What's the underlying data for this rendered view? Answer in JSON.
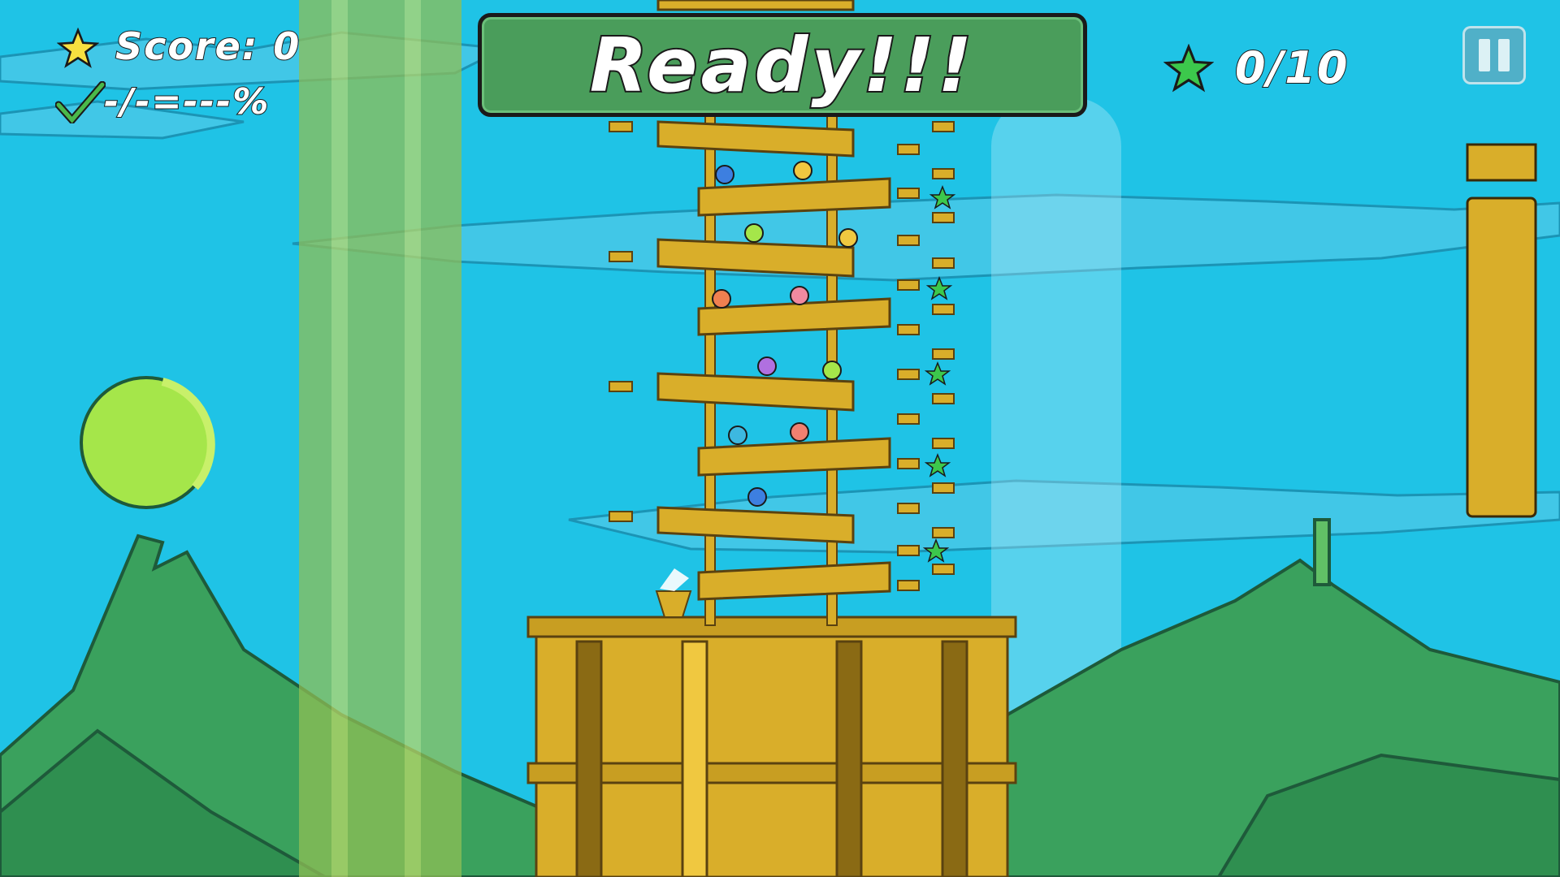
{
  "hud": {
    "score_label": "Score: 0",
    "accuracy_label": "-/-=---%",
    "stars_collected": "0/10",
    "banner_text": "Ready!!!"
  },
  "icons": {
    "score": "star-icon",
    "accuracy": "checkmark-icon",
    "stars": "green-star-icon",
    "pause": "pause-icon"
  },
  "colors": {
    "sky": "#1fc3e6",
    "banner": "#4a9d5b",
    "hills": "#3fa561",
    "bricks": "#d9ae2a",
    "planet": "#a5e64a"
  }
}
